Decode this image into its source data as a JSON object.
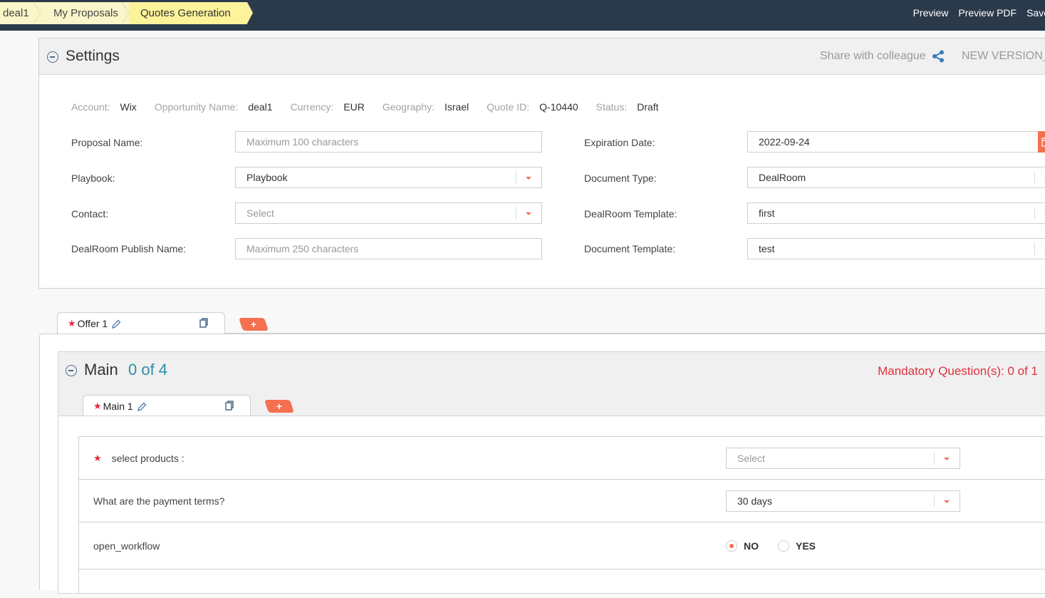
{
  "breadcrumb": [
    "deal1",
    "My Proposals",
    "Quotes Generation"
  ],
  "top_actions": {
    "preview": "Preview",
    "preview_pdf": "Preview PDF",
    "save": "Save"
  },
  "settings": {
    "title": "Settings",
    "share_label": "Share with colleague",
    "new_version_label": "NEW VERSION_",
    "meta": [
      {
        "key": "Account:",
        "value": "Wix"
      },
      {
        "key": "Opportunity Name:",
        "value": "deal1"
      },
      {
        "key": "Currency:",
        "value": "EUR"
      },
      {
        "key": "Geography:",
        "value": "Israel"
      },
      {
        "key": "Quote ID:",
        "value": "Q-10440"
      },
      {
        "key": "Status:",
        "value": "Draft"
      }
    ],
    "left_fields": [
      {
        "label": "Proposal Name:",
        "value": "",
        "placeholder": "Maximum 100 characters",
        "type": "text"
      },
      {
        "label": "Playbook:",
        "value": "Playbook",
        "placeholder": "",
        "type": "select"
      },
      {
        "label": "Contact:",
        "value": "",
        "placeholder": "Select",
        "type": "select"
      },
      {
        "label": "DealRoom Publish Name:",
        "value": "",
        "placeholder": "Maximum 250 characters",
        "type": "text"
      }
    ],
    "right_fields": [
      {
        "label": "Expiration Date:",
        "value": "2022-09-24",
        "type": "date"
      },
      {
        "label": "Document Type:",
        "value": "DealRoom",
        "type": "select"
      },
      {
        "label": "DealRoom Template:",
        "value": "first",
        "type": "select"
      },
      {
        "label": "Document Template:",
        "value": "test",
        "type": "select"
      }
    ]
  },
  "offer_tabs": [
    {
      "label": "Offer 1",
      "required": true
    }
  ],
  "add_offer_label": "+",
  "main_section": {
    "title": "Main",
    "count": "0 of 4",
    "mandatory": "Mandatory Question(s): 0 of 1",
    "tabs": [
      {
        "label": "Main 1",
        "required": true
      }
    ],
    "add_label": "+",
    "questions": [
      {
        "label": "select products :",
        "required": true,
        "type": "select",
        "value": "",
        "placeholder": "Select"
      },
      {
        "label": "What are the payment terms?",
        "required": false,
        "type": "select",
        "value": "30 days",
        "placeholder": ""
      },
      {
        "label": "open_workflow",
        "required": false,
        "type": "radio",
        "options": [
          "NO",
          "YES"
        ],
        "selected": "NO"
      }
    ]
  },
  "colors": {
    "accent": "#f4704e",
    "topbar": "#2b3a4b",
    "breadcrumb": "#fbf6c9",
    "count": "#2a8faa",
    "mandatory": "#e0313c",
    "share_icon": "#3b7bbf"
  }
}
